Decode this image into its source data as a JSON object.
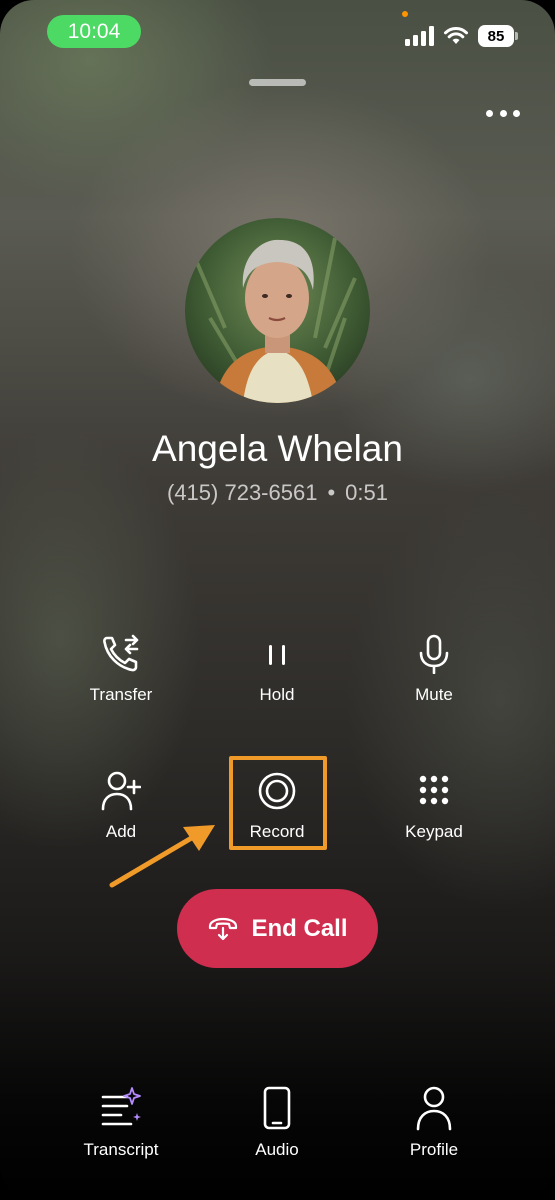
{
  "status_bar": {
    "time": "10:04",
    "battery": "85"
  },
  "contact": {
    "name": "Angela Whelan",
    "phone": "(415) 723-6561",
    "separator": "•",
    "duration": "0:51"
  },
  "controls": {
    "transfer": "Transfer",
    "hold": "Hold",
    "mute": "Mute",
    "add": "Add",
    "record": "Record",
    "keypad": "Keypad"
  },
  "end_call_label": "End Call",
  "bottom_nav": {
    "transcript": "Transcript",
    "audio": "Audio",
    "profile": "Profile"
  },
  "colors": {
    "time_pill": "#4cd964",
    "end_call": "#cf2e4f",
    "annotation": "#f09a2a",
    "sparkle": "#b58cff"
  },
  "icons": [
    "signal-icon",
    "wifi-icon",
    "more-icon",
    "transfer-icon",
    "hold-icon",
    "mic-icon",
    "add-person-icon",
    "record-icon",
    "keypad-icon",
    "end-call-icon",
    "transcript-icon",
    "phone-device-icon",
    "person-icon"
  ]
}
